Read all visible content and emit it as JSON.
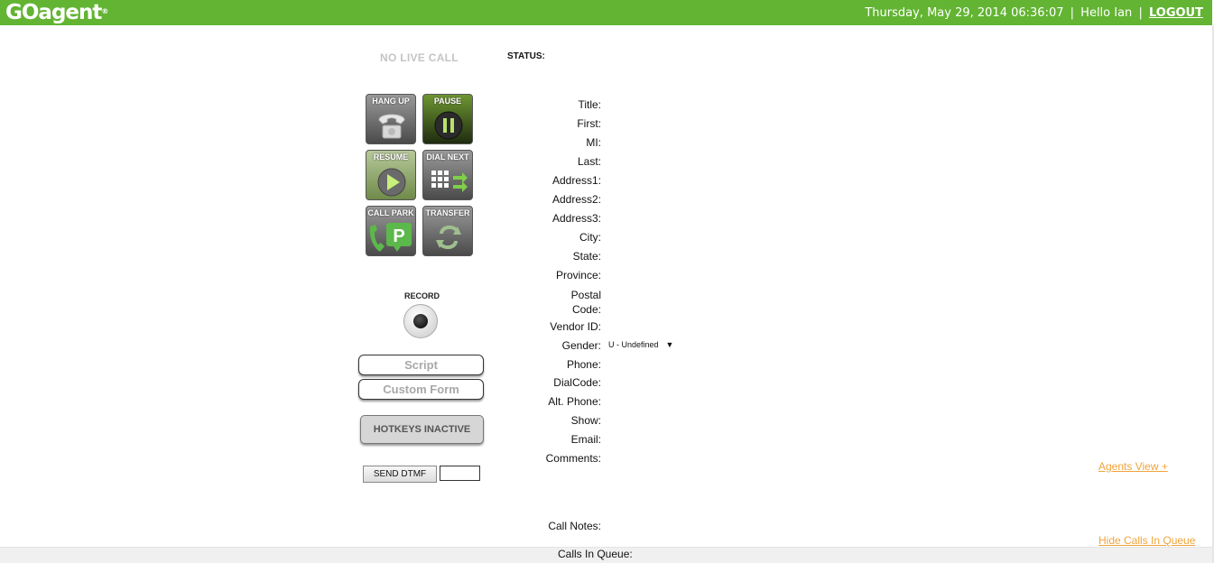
{
  "header": {
    "logo": "GOagent",
    "logo_mark": "®",
    "datetime": "Thursday, May 29, 2014 06:36:07",
    "separator": "|",
    "greeting": "Hello Ian",
    "logout": "LOGOUT",
    "bar_color": "#62b432"
  },
  "call": {
    "live_status": "NO LIVE CALL",
    "status_label": "STATUS:"
  },
  "controls": {
    "hang_up": "HANG UP",
    "pause": "PAUSE",
    "resume": "RESUME",
    "dial_next": "DIAL NEXT",
    "call_park": "CALL PARK",
    "transfer": "TRANSFER",
    "record": "RECORD",
    "script": "Script",
    "custom_form": "Custom Form",
    "hotkeys": "HOTKEYS INACTIVE",
    "send_dtmf": "SEND DTMF",
    "dtmf_value": ""
  },
  "fields": {
    "title": "Title:",
    "first": "First:",
    "mi": "MI:",
    "last": "Last:",
    "address1": "Address1:",
    "address2": "Address2:",
    "address3": "Address3:",
    "city": "City:",
    "state": "State:",
    "province": "Province:",
    "postal_code": "Postal Code:",
    "vendor_id": "Vendor ID:",
    "gender": "Gender:",
    "gender_value": "U - Undefined",
    "phone": "Phone:",
    "dialcode": "DialCode:",
    "alt_phone": "Alt. Phone:",
    "show": "Show:",
    "email": "Email:",
    "comments": "Comments:",
    "call_notes": "Call Notes:",
    "calls_in_queue": "Calls In Queue:"
  },
  "links": {
    "agents_view": "Agents View +",
    "hide_calls": "Hide Calls In Queue",
    "link_color": "#f0a43c"
  }
}
